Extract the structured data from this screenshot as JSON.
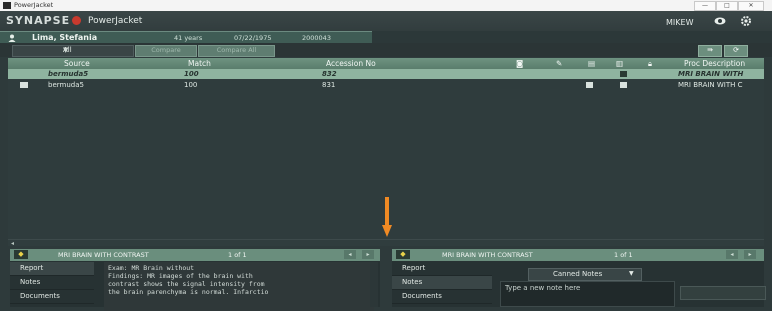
{
  "os_window": {
    "title": "PowerJacket",
    "buttons": [
      "min",
      "max",
      "close"
    ]
  },
  "brand": {
    "logo": "SYNAPSE",
    "app_name": "PowerJacket",
    "user": "MIKEW"
  },
  "patient": {
    "name": "Lima, Stefania",
    "age": "41 years",
    "dob": "07/22/1975",
    "id": "2000043"
  },
  "toolbar": {
    "filter": "All",
    "compare1": "Compare",
    "compare2": "Compare All"
  },
  "grid": {
    "columns": [
      "Source",
      "Match",
      "Accession No",
      "Proc Description"
    ],
    "rows": [
      {
        "source": "bermuda5",
        "match": "100",
        "accession": "832",
        "proc": "MRI BRAIN WITH"
      },
      {
        "source": "bermuda5",
        "match": "100",
        "accession": "831",
        "proc": "MRI BRAIN WITH C"
      }
    ]
  },
  "left_pane": {
    "header": "MRI BRAIN WITH CONTRAST",
    "counter": "1 of 1",
    "side_items": [
      "Report",
      "Notes",
      "Documents"
    ],
    "findings_lines": [
      "Exam: MR Brain without",
      "",
      "Findings: MR images of the brain with",
      "contrast shows the signal intensity from",
      "the brain parenchyma is normal. Infarctio"
    ]
  },
  "right_pane": {
    "header": "MRI BRAIN WITH CONTRAST",
    "counter": "1 of 1",
    "side_items": [
      "Report",
      "Notes",
      "Documents"
    ],
    "canned_label": "Canned Notes",
    "note_placeholder": "Type a new note here"
  },
  "colors": {
    "accent": "#6a8e7d",
    "selected_row": "#8fb4a0",
    "arrow": "#f08a24",
    "logo_mark": "#c83a2e"
  }
}
